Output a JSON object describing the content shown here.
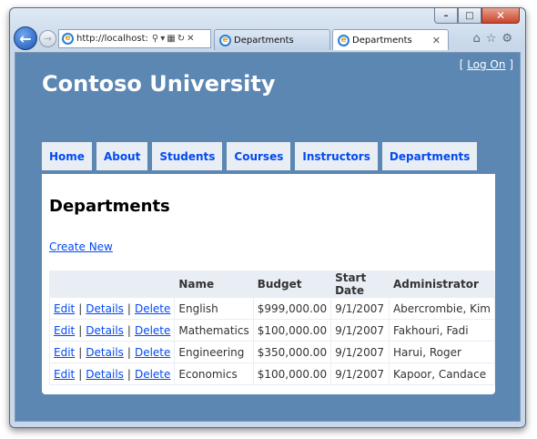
{
  "browser": {
    "address": "http://localhost:",
    "tabs": [
      {
        "label": "Departments",
        "active": false
      },
      {
        "label": "Departments",
        "active": true
      }
    ],
    "caption": {
      "minimize": "–",
      "maximize": "□",
      "close": "✕"
    }
  },
  "header": {
    "login_open": "[ ",
    "login_link": "Log On",
    "login_close": " ]",
    "site_title": "Contoso University"
  },
  "menu": [
    "Home",
    "About",
    "Students",
    "Courses",
    "Instructors",
    "Departments"
  ],
  "page": {
    "title": "Departments",
    "create_link": "Create New"
  },
  "table": {
    "columns": [
      "",
      "Name",
      "Budget",
      "Start Date",
      "Administrator"
    ],
    "actions": [
      "Edit",
      "Details",
      "Delete"
    ],
    "rows": [
      {
        "name": "English",
        "budget": "$999,000.00",
        "start": "9/1/2007",
        "admin": "Abercrombie, Kim"
      },
      {
        "name": "Mathematics",
        "budget": "$100,000.00",
        "start": "9/1/2007",
        "admin": "Fakhouri, Fadi"
      },
      {
        "name": "Engineering",
        "budget": "$350,000.00",
        "start": "9/1/2007",
        "admin": "Harui, Roger"
      },
      {
        "name": "Economics",
        "budget": "$100,000.00",
        "start": "9/1/2007",
        "admin": "Kapoor, Candace"
      }
    ]
  },
  "colors": {
    "page_bg": "#5c87b2",
    "link": "#034af3",
    "menu_bg": "#e8eef4"
  }
}
